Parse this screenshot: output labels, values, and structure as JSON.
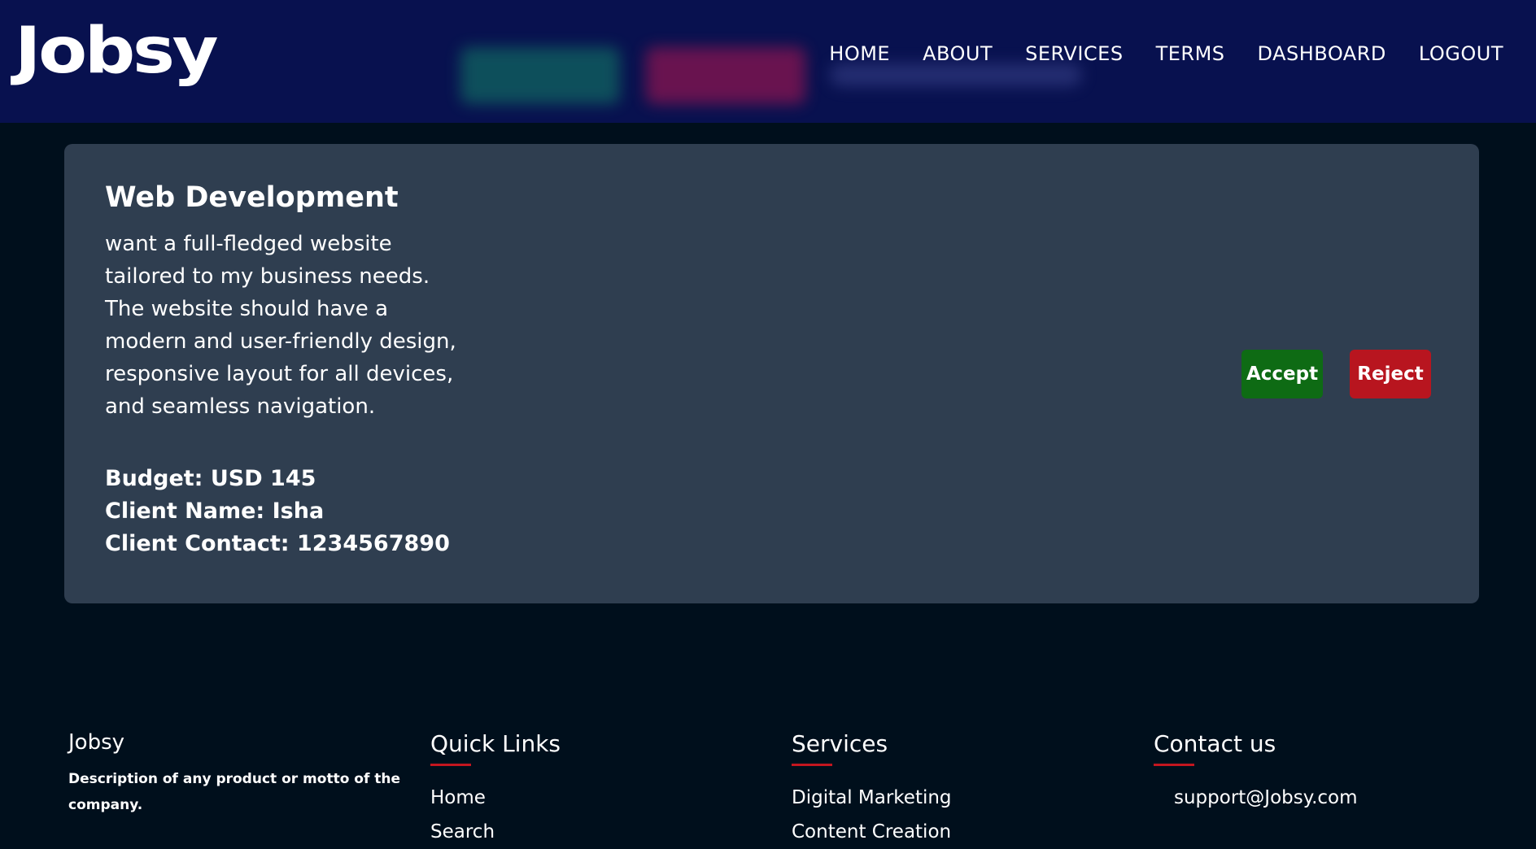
{
  "header": {
    "logo": "Jobsy",
    "nav": [
      "HOME",
      "ABOUT",
      "SERVICES",
      "TERMS",
      "DASHBOARD",
      "LOGOUT"
    ]
  },
  "card": {
    "title": "Web Development",
    "description": "want a full-fledged website tailored to my business needs. The website should have a modern and user-friendly design, responsive layout for all devices, and seamless navigation.",
    "budget": "Budget: USD 145",
    "client_name": "Client Name: Isha",
    "client_contact": "Client Contact: 1234567890",
    "accept_label": "Accept",
    "reject_label": "Reject"
  },
  "footer": {
    "brand_title": "Jobsy",
    "brand_desc": "Description of any product or motto of the company.",
    "quick_links": {
      "heading": "Quick Links",
      "items": [
        "Home",
        "Search"
      ]
    },
    "services": {
      "heading": "Services",
      "items": [
        "Digital Marketing",
        "Content Creation"
      ]
    },
    "contact": {
      "heading": "Contact us",
      "email": "support@Jobsy.com"
    }
  },
  "colors": {
    "header_bg": "#08114f",
    "page_bg": "#000f1c",
    "card_bg": "#2f3e50",
    "accept": "#0e6b14",
    "reject": "#b8151f",
    "accent_underline": "#c4161f"
  }
}
